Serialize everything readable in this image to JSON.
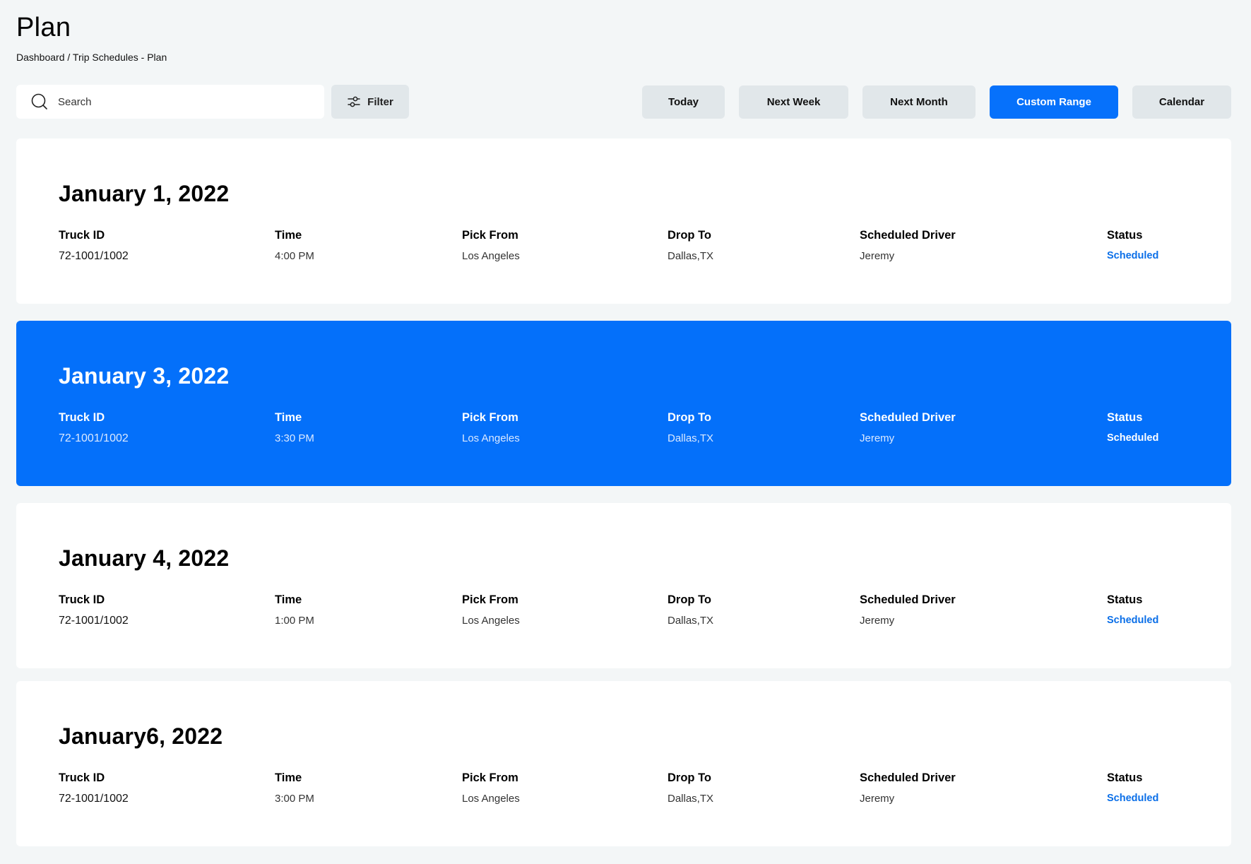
{
  "page": {
    "title": "Plan",
    "breadcrumb": "Dashboard / Trip Schedules - Plan"
  },
  "toolbar": {
    "search_placeholder": "Search",
    "filter_label": "Filter",
    "range_buttons": [
      {
        "label": "Today",
        "active": false
      },
      {
        "label": "Next Week",
        "active": false
      },
      {
        "label": "Next Month",
        "active": false
      },
      {
        "label": "Custom Range",
        "active": true
      },
      {
        "label": "Calendar",
        "active": false
      }
    ]
  },
  "columns": [
    "Truck ID",
    "Time",
    "Pick From",
    "Drop To",
    "Scheduled Driver",
    "Status"
  ],
  "trips": [
    {
      "date": "January 1, 2022",
      "truck_id": "72-1001/1002",
      "time": "4:00 PM",
      "pick_from": "Los Angeles",
      "drop_to": "Dallas,TX",
      "driver": "Jeremy",
      "status": "Scheduled",
      "highlighted": false
    },
    {
      "date": "January 3, 2022",
      "truck_id": "72-1001/1002",
      "time": "3:30 PM",
      "pick_from": "Los Angeles",
      "drop_to": "Dallas,TX",
      "driver": "Jeremy",
      "status": "Scheduled",
      "highlighted": true
    },
    {
      "date": "January 4, 2022",
      "truck_id": "72-1001/1002",
      "time": "1:00 PM",
      "pick_from": "Los Angeles",
      "drop_to": "Dallas,TX",
      "driver": "Jeremy",
      "status": "Scheduled",
      "highlighted": false
    },
    {
      "date": "January6, 2022",
      "truck_id": "72-1001/1002",
      "time": "3:00 PM",
      "pick_from": "Los Angeles",
      "drop_to": "Dallas,TX",
      "driver": "Jeremy",
      "status": "Scheduled",
      "highlighted": false
    }
  ],
  "colors": {
    "accent": "#0671fb",
    "status_text": "#0b6fe8",
    "background": "#f3f6f7",
    "button_bg": "#e1e7ea"
  }
}
